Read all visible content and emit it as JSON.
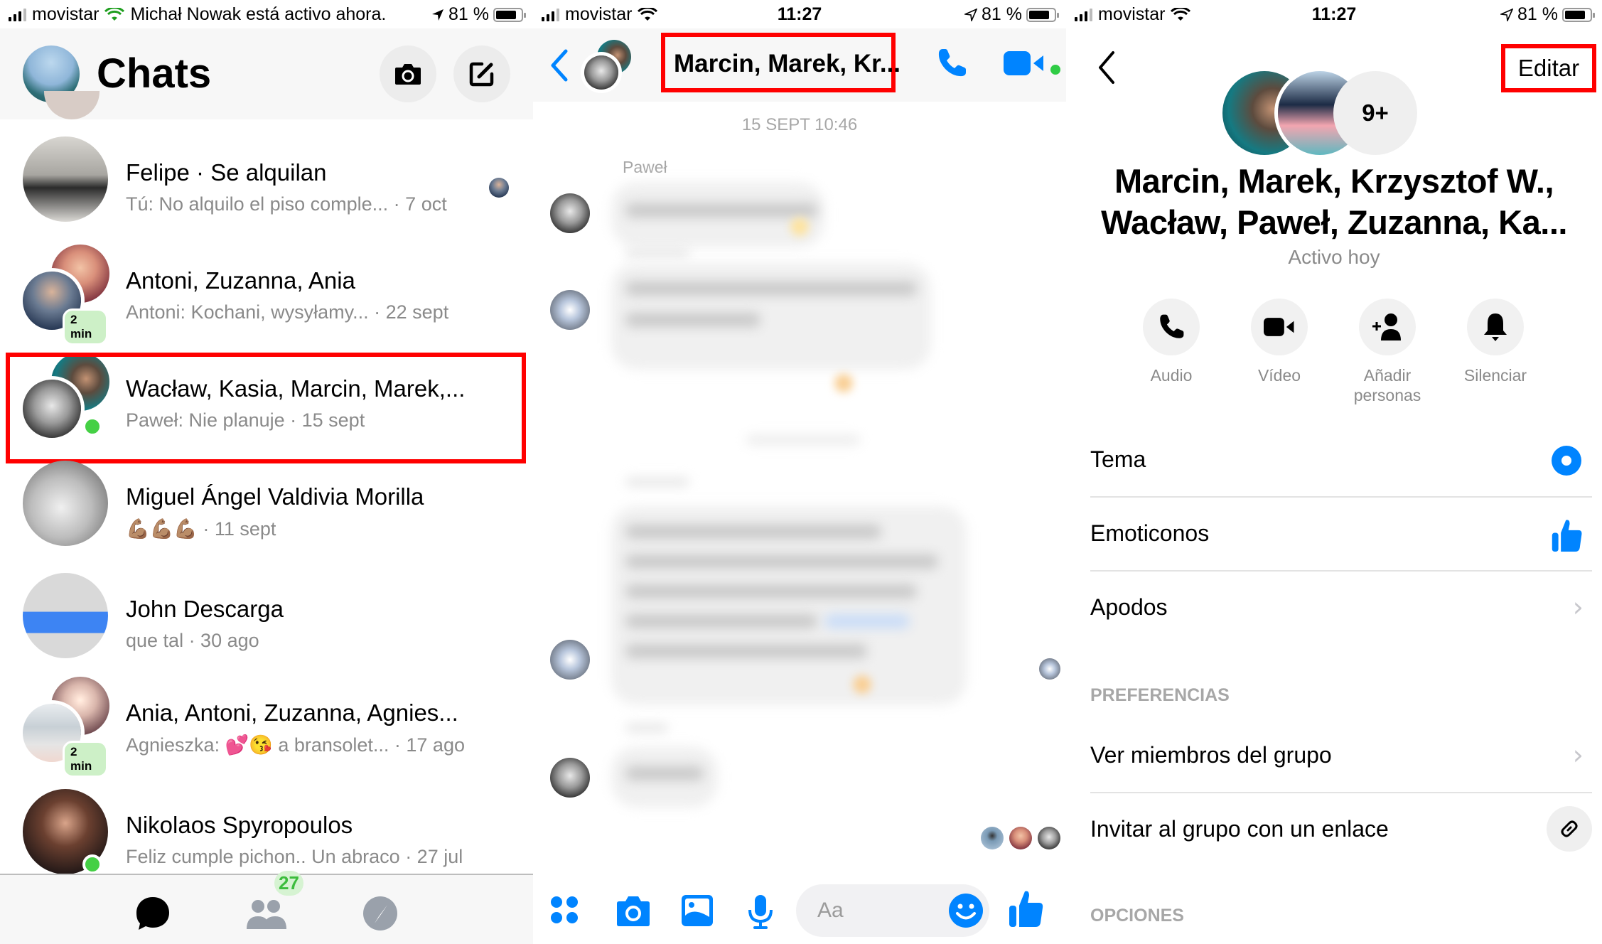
{
  "statusbar_left": {
    "carrier": "movistar",
    "overlay_text": "Michał Nowak está activo ahora.",
    "time_overlapped": "11:27",
    "battery": "81 %",
    "battery_level_percent": 81
  },
  "statusbar": {
    "carrier": "movistar",
    "time": "11:27",
    "battery": "81 %",
    "battery_level_percent": 81
  },
  "chats_screen": {
    "title": "Chats",
    "camera_icon": "camera-icon",
    "compose_icon": "compose-icon",
    "conversations": [
      {
        "name": "Felipe · Se alquilan",
        "preview": "Tú: No alquilo el piso comple... · 7 oct",
        "seen_by_avatar": true
      },
      {
        "name": "Antoni, Zuzanna, Ania",
        "preview": "Antoni: Kochani, wysyłamy...    · 22 sept",
        "badge": "2 min"
      },
      {
        "name": "Wacław, Kasia, Marcin, Marek,...",
        "preview": "Paweł: Nie planuje · 15 sept",
        "online": true,
        "highlighted": true
      },
      {
        "name": "Miguel Ángel Valdivia Morilla",
        "preview": "💪🏽💪🏽💪🏽 · 11 sept"
      },
      {
        "name": "John Descarga",
        "preview": "que tal · 30 ago"
      },
      {
        "name": "Ania, Antoni, Zuzanna, Agnies...",
        "preview": "Agnieszka: 💕😘 a bransolet...  · 17 ago",
        "badge": "2 min"
      },
      {
        "name": "Nikolaos Spyropoulos",
        "preview": "Feliz cumple pichon.. Un abraco · 27 jul",
        "online": true
      }
    ],
    "tabbar": {
      "tabs": [
        {
          "name": "chats",
          "icon": "chat-bubble-icon",
          "active": true
        },
        {
          "name": "people",
          "icon": "people-icon",
          "badge": "27"
        },
        {
          "name": "discover",
          "icon": "compass-icon"
        }
      ]
    }
  },
  "conversation_screen": {
    "title": "Marcin, Marek, Kr...",
    "back_icon": "chevron-left-icon",
    "call_icon": "phone-icon",
    "video_icon": "video-camera-icon",
    "date_divider": "15 SEPT 10:46",
    "first_sender": "Paweł",
    "messages_blurred": true,
    "composer": {
      "placeholder": "Aa",
      "icons": [
        "apps-icon",
        "camera-icon",
        "photo-icon",
        "microphone-icon",
        "emoji-icon",
        "thumbs-up-icon"
      ]
    }
  },
  "group_info_screen": {
    "edit_label": "Editar",
    "more_members": "9+",
    "group_name": "Marcin, Marek, Krzysztof W., Wacław, Paweł, Zuzanna, Ka...",
    "group_name_line1": "Marcin, Marek, Krzysztof W.,",
    "group_name_line2": "Wacław, Paweł, Zuzanna, Ka...",
    "status": "Activo hoy",
    "actions": [
      {
        "label": "Audio",
        "icon": "phone-icon"
      },
      {
        "label": "Vídeo",
        "icon": "video-camera-icon"
      },
      {
        "label": "Añadir personas",
        "label_line1": "Añadir",
        "label_line2": "personas",
        "icon": "add-person-icon"
      },
      {
        "label": "Silenciar",
        "icon": "bell-icon"
      }
    ],
    "rows": [
      {
        "label": "Tema",
        "accessory": "theme-color-icon"
      },
      {
        "label": "Emoticonos",
        "accessory": "thumbs-up-icon"
      },
      {
        "label": "Apodos",
        "accessory": "chevron-right-icon"
      }
    ],
    "preferences_header": "PREFERENCIAS",
    "preference_rows": [
      {
        "label": "Ver miembros del grupo",
        "accessory": "chevron-right-icon"
      },
      {
        "label": "Invitar al grupo con un enlace",
        "accessory": "link-icon"
      }
    ],
    "options_header": "OPCIONES"
  },
  "colors": {
    "messenger_blue": "#0084ff",
    "online_green": "#45d045",
    "highlight_red": "#ff0000",
    "secondary_text": "#8a8a8a"
  }
}
